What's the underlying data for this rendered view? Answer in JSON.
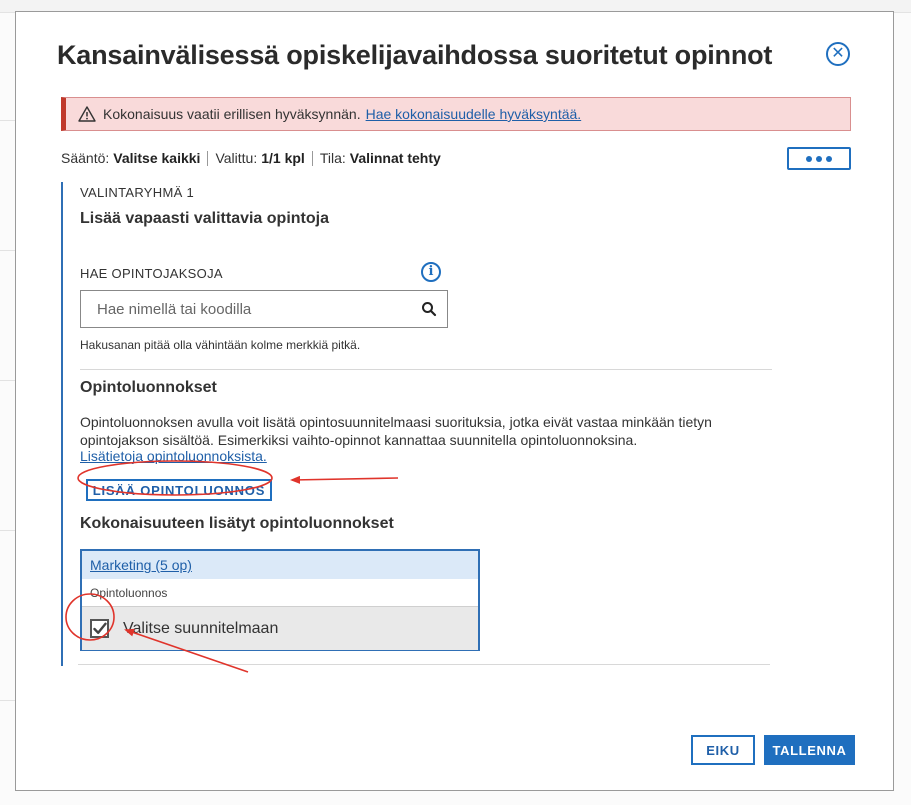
{
  "modal": {
    "title": "Kansainvälisessä opiskelijavaihdossa suoritetut opinnot"
  },
  "alert": {
    "text": "Kokonaisuus vaatii erillisen hyväksynnän.",
    "link": "Hae kokonaisuudelle hyväksyntää."
  },
  "rules": {
    "rule_label": "Sääntö:",
    "rule_value": "Valitse kaikki",
    "selected_label": "Valittu:",
    "selected_value": "1/1 kpl",
    "status_label": "Tila:",
    "status_value": "Valinnat tehty"
  },
  "group": {
    "label": "VALINTARYHMÄ 1",
    "title": "Lisää vapaasti valittavia opintoja",
    "search_label": "HAE OPINTOJAKSOJA",
    "search_placeholder": "Hae nimellä tai koodilla",
    "hint": "Hakusanan pitää olla vähintään kolme merkkiä pitkä."
  },
  "drafts": {
    "title": "Opintoluonnokset",
    "description": "Opintoluonnoksen avulla voit lisätä opintosuunnitelmaasi suorituksia, jotka eivät vastaa minkään tietyn opintojakson sisältöä. Esimerkiksi vaihto-opinnot kannattaa suunnitella opintoluonnoksina.",
    "info_link": "Lisätietoja opintoluonnoksista.",
    "add_button": "LISÄÄ OPINTOLUONNOS",
    "added_title": "Kokonaisuuteen lisätyt opintoluonnokset",
    "cards": [
      {
        "name": "Marketing (5 op)",
        "type": "Opintoluonnos",
        "select_label": "Valitse suunnitelmaan",
        "checked": true
      }
    ]
  },
  "footer": {
    "cancel": "EIKU",
    "save": "TALLENNA"
  },
  "colors": {
    "accent": "#1f6fbf",
    "alert_bg": "#f9dada",
    "alert_border": "#c0392b",
    "annotation": "#e0342b"
  },
  "icons": [
    "close-icon",
    "warning-icon",
    "more-icon",
    "info-icon",
    "search-icon",
    "checkmark-icon"
  ]
}
